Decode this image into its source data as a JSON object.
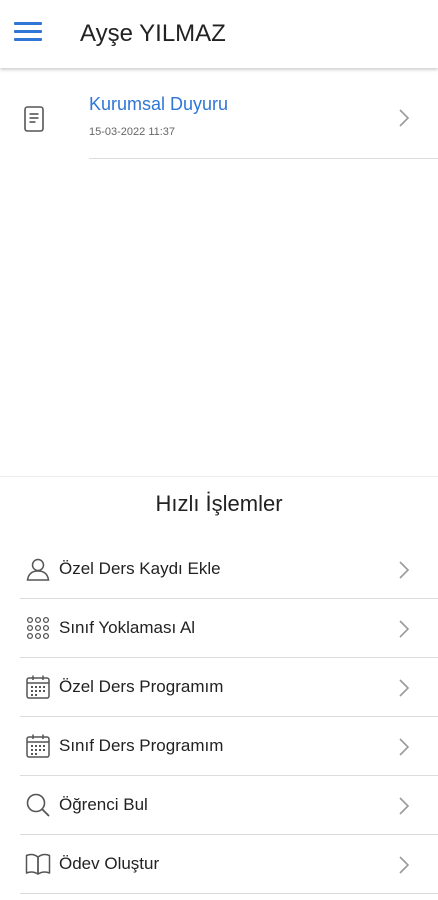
{
  "header": {
    "title": "Ayşe YILMAZ",
    "menu_icon": "menu-icon"
  },
  "announcements": [
    {
      "title": "Kurumsal Duyuru",
      "date": "15-03-2022 11:37",
      "icon": "document-icon"
    }
  ],
  "quick_actions": {
    "title": "Hızlı İşlemler",
    "items": [
      {
        "label": "Özel Ders Kaydı Ekle",
        "icon": "user-icon"
      },
      {
        "label": "Sınıf Yoklaması Al",
        "icon": "grid-dots-icon"
      },
      {
        "label": "Özel Ders Programım",
        "icon": "calendar-icon"
      },
      {
        "label": "Sınıf Ders Programım",
        "icon": "calendar-icon"
      },
      {
        "label": "Öğrenci Bul",
        "icon": "search-icon"
      },
      {
        "label": "Ödev Oluştur",
        "icon": "book-icon"
      }
    ]
  },
  "colors": {
    "accent": "#2f76d6",
    "divider": "#dcdcdc",
    "icon": "#555555"
  }
}
